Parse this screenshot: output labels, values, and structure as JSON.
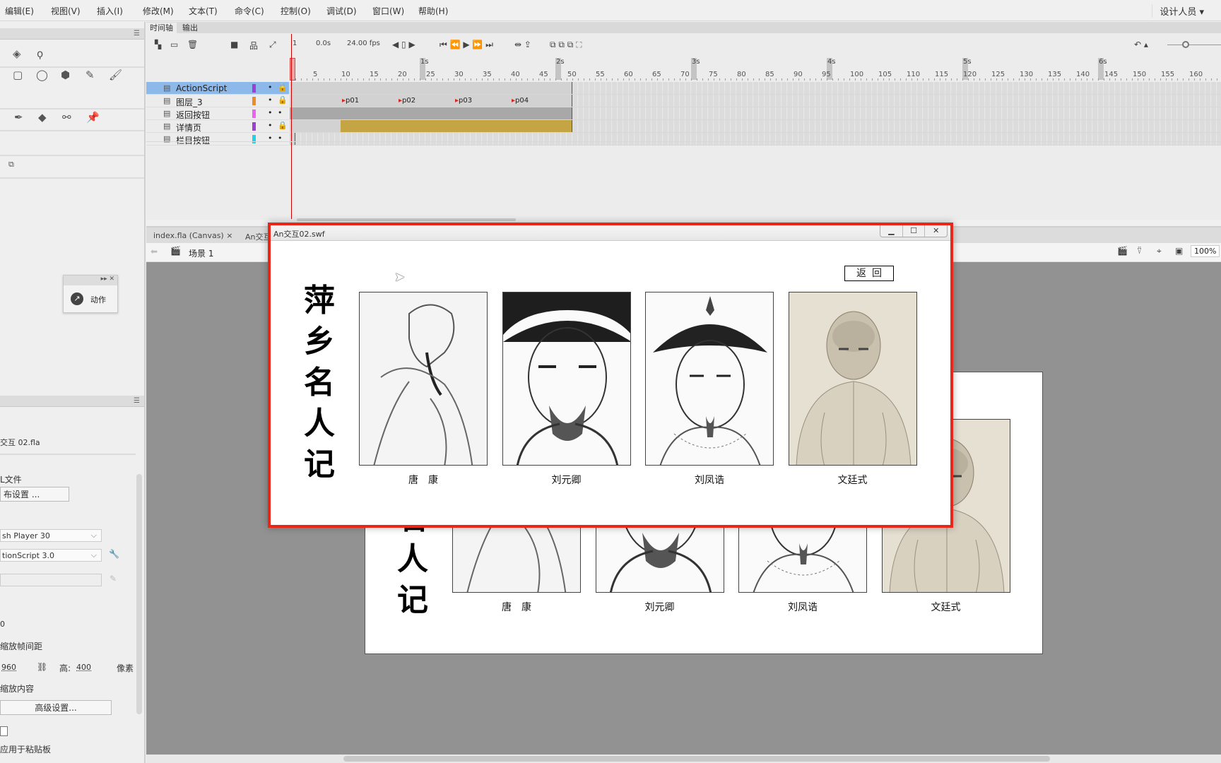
{
  "menu": [
    "编辑(E)",
    "视图(V)",
    "插入(I)",
    "修改(M)",
    "文本(T)",
    "命令(C)",
    "控制(O)",
    "调试(D)",
    "窗口(W)",
    "帮助(H)"
  ],
  "workspace": "设计人员 ▾",
  "timeline": {
    "tabs": [
      "时间轴",
      "输出"
    ],
    "frame": "1",
    "time": "0.0s",
    "fps": "24.00 fps",
    "ruler": [
      1,
      5,
      10,
      15,
      20,
      25,
      30,
      35,
      40,
      45,
      50,
      55,
      60,
      65,
      70,
      75,
      80,
      85,
      90,
      95,
      100,
      105,
      110,
      115,
      120,
      125,
      130,
      135,
      140,
      145,
      150,
      155,
      160
    ],
    "seconds": [
      {
        "frame": 24,
        "label": "1s"
      },
      {
        "frame": 48,
        "label": "2s"
      },
      {
        "frame": 72,
        "label": "3s"
      },
      {
        "frame": 96,
        "label": "4s"
      },
      {
        "frame": 120,
        "label": "5s"
      },
      {
        "frame": 144,
        "label": "6s"
      }
    ],
    "layers": [
      {
        "name": "ActionScript",
        "color": "#9b3fd6",
        "selected": true,
        "locked": true,
        "end": 50
      },
      {
        "name": "图层_3",
        "color": "#f08a24",
        "locked": true,
        "end": 50,
        "labels": [
          {
            "frame": 10,
            "text": "p01"
          },
          {
            "frame": 20,
            "text": "p02"
          },
          {
            "frame": 30,
            "text": "p03"
          },
          {
            "frame": 40,
            "text": "p04"
          }
        ]
      },
      {
        "name": "返回按钮",
        "color": "#f060f0",
        "locked": false,
        "end": 50
      },
      {
        "name": "详情页",
        "color": "#9b3fd6",
        "locked": true,
        "end": 50,
        "tween_start": 10
      },
      {
        "name": "栏目按钮",
        "color": "#22d3e8",
        "locked": false,
        "end": 1
      }
    ],
    "tween_color": "#c4a443"
  },
  "docs": {
    "tabs": [
      "index.fla (Canvas)  ×",
      "An交互"
    ],
    "scene": "场景 1",
    "zoom": "100%"
  },
  "left": {
    "actions_label": "动作",
    "file": "交互 02.fla",
    "text1": "L文件",
    "publish_btn": "布设置 ...",
    "player": "sh Player 30",
    "script": "tionScript 3.0",
    "fps_val": "0",
    "scale_spacing": "缩放帧间距",
    "width": "960",
    "height_label": "高:",
    "height": "400",
    "unit": "像素",
    "scale_content": "缩放内容",
    "advanced_btn": "高级设置...",
    "clipboard": "应用于粘贴板"
  },
  "swf": {
    "title": "An交互02.swf",
    "back": "返回",
    "heading": [
      "萍",
      "乡",
      "名",
      "人",
      "记"
    ],
    "people": [
      "唐　康",
      "刘元卿",
      "刘凤诰",
      "文廷式"
    ]
  },
  "accent": "#e8261a"
}
